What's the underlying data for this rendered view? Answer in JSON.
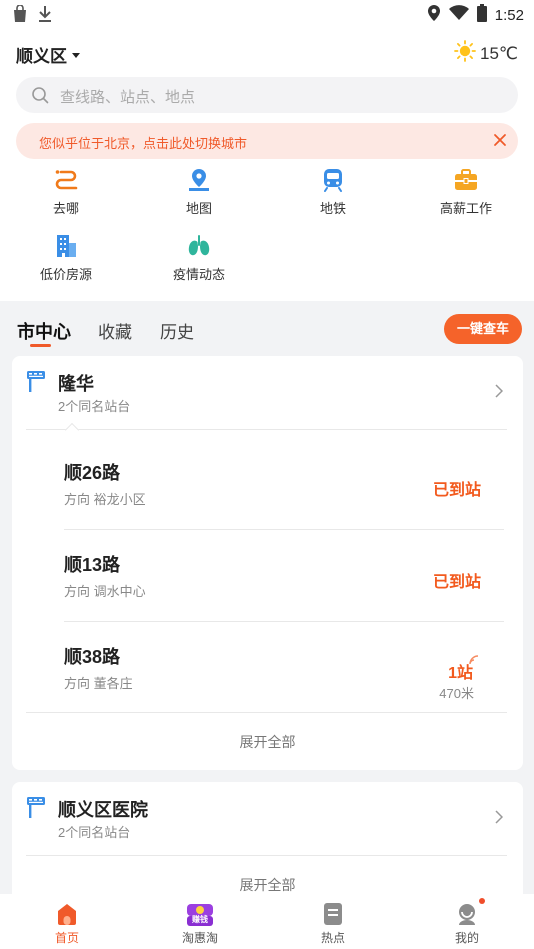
{
  "status_bar": {
    "time": "1:52"
  },
  "header": {
    "city": "顺义区",
    "temperature": "15℃"
  },
  "search": {
    "placeholder": "查线路、站点、地点"
  },
  "notice": {
    "text": "您似乎位于北京，点击此处切换城市"
  },
  "grid": [
    {
      "label": "去哪",
      "icon": "route-icon"
    },
    {
      "label": "地图",
      "icon": "map-pin-icon"
    },
    {
      "label": "地铁",
      "icon": "subway-icon"
    },
    {
      "label": "高薪工作",
      "icon": "briefcase-icon"
    },
    {
      "label": "低价房源",
      "icon": "building-icon"
    },
    {
      "label": "疫情动态",
      "icon": "lungs-icon"
    }
  ],
  "tabs": {
    "items": [
      "市中心",
      "收藏",
      "历史"
    ],
    "active": 0,
    "check_button": "一键查车"
  },
  "cards": [
    {
      "stop_name": "隆华",
      "stop_sub": "2个同名站台",
      "routes": [
        {
          "name": "顺26路",
          "direction": "方向 裕龙小区",
          "status": "已到站"
        },
        {
          "name": "顺13路",
          "direction": "方向 调水中心",
          "status": "已到站"
        },
        {
          "name": "顺38路",
          "direction": "方向 董各庄",
          "status": "1站",
          "distance": "470米"
        }
      ],
      "expand": "展开全部"
    },
    {
      "stop_name": "顺义区医院",
      "stop_sub": "2个同名站台",
      "expand": "展开全部"
    }
  ],
  "tabbar": [
    {
      "label": "首页",
      "icon": "home-icon",
      "active": true
    },
    {
      "label": "淘惠淘",
      "icon": "treasure-icon",
      "badge": "赚钱"
    },
    {
      "label": "热点",
      "icon": "news-icon"
    },
    {
      "label": "我的",
      "icon": "profile-icon",
      "dot": true
    }
  ],
  "colors": {
    "accent": "#f05a2a",
    "status": "#f25a1e"
  }
}
